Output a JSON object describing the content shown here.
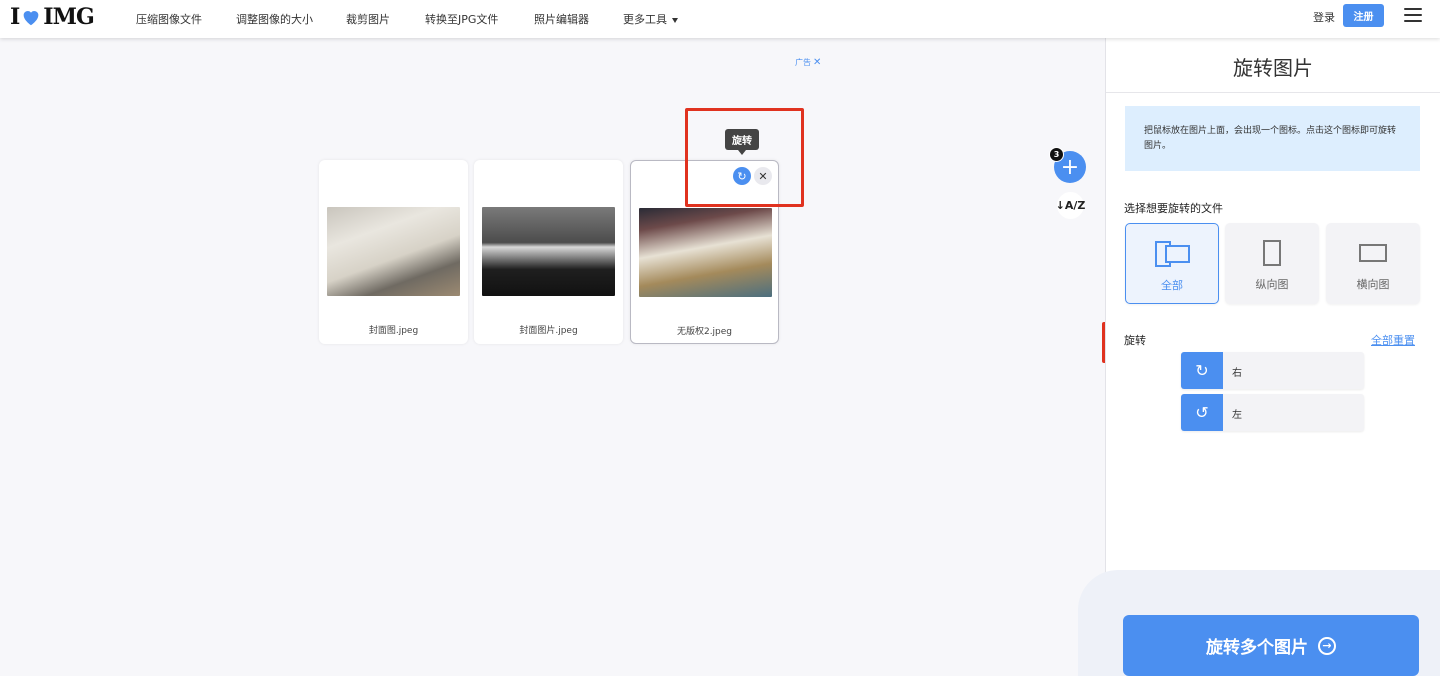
{
  "header": {
    "logo_left": "I",
    "logo_right": "IMG",
    "nav": [
      "压缩图像文件",
      "调整图像的大小",
      "裁剪图片",
      "转换至JPG文件",
      "照片编辑器",
      "更多工具"
    ],
    "login": "登录",
    "signup": "注册"
  },
  "main": {
    "ad_label": "广告",
    "ad_close": "✕",
    "files": [
      {
        "name": "封面图.jpeg"
      },
      {
        "name": "封面图片.jpeg"
      },
      {
        "name": "无版权2.jpeg"
      }
    ],
    "tooltip": "旋转",
    "rotate_icon": "↻",
    "remove_icon": "✕",
    "add_icon": "+",
    "file_count": "3",
    "sort_icon": "↓A/Z"
  },
  "sidebar": {
    "title": "旋转图片",
    "info": "把鼠标放在图片上面，会出现一个图标。点击这个图标即可旋转图片。",
    "select_label": "选择想要旋转的文件",
    "orientations": [
      {
        "label": "全部",
        "icon": "all-orientation-icon",
        "active": true
      },
      {
        "label": "纵向图",
        "icon": "portrait-icon"
      },
      {
        "label": "横向图",
        "icon": "landscape-icon"
      }
    ],
    "rotate_label": "旋转",
    "reset_all": "全部重置",
    "right": {
      "icon": "↻",
      "label": "右"
    },
    "left": {
      "icon": "↺",
      "label": "左"
    },
    "cta": "旋转多个图片",
    "cta_icon": "→"
  },
  "colors": {
    "accent": "#4b8ff0",
    "highlight": "#e0321f"
  }
}
